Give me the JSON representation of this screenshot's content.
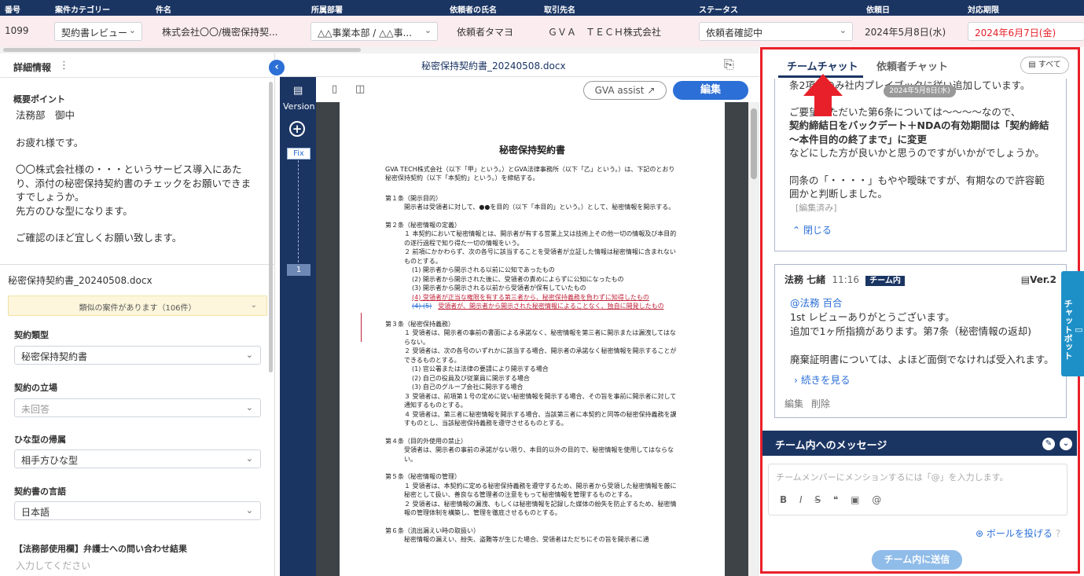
{
  "header": {
    "cols": [
      "番号",
      "案件カテゴリー",
      "件名",
      "所属部署",
      "依頼者の氏名",
      "取引先名",
      "ステータス",
      "依頼日",
      "対応期限"
    ]
  },
  "row": {
    "number": "1099",
    "category": "契約書レビュー",
    "subject": "株式会社〇〇/機密保持契...",
    "department": "△△事業本部 / △△事...",
    "requester": "依頼者タマヨ",
    "client": "ＧＶＡ　ＴＥＣＨ株式会社",
    "status": "依頼者確認中",
    "request_date": "2024年5月8日(水)",
    "deadline": "2024年6月7日(金)",
    "deadline_color": "#e8202a"
  },
  "left": {
    "title": "詳細情報",
    "summary_label": "概要ポイント",
    "summary_lines": [
      "法務部　御中",
      "お疲れ様です。",
      "〇〇株式会社様の・・・というサービス導入にあたり、添付の秘密保持契約書のチェックをお願いできますでしょうか。",
      "先方のひな型になります。",
      "ご確認のほど宜しくお願い致します。"
    ],
    "file_name": "秘密保持契約書_20240508.docx",
    "similar": "類似の案件があります（106件）",
    "fields": [
      {
        "label": "契約類型",
        "value": "秘密保持契約書"
      },
      {
        "label": "契約の立場",
        "value": "未回答"
      },
      {
        "label": "ひな型の帰属",
        "value": "相手方ひな型"
      },
      {
        "label": "契約書の言語",
        "value": "日本語"
      }
    ],
    "inquiry_label": "【法務部使用欄】弁護士への問い合わせ結果",
    "inquiry_placeholder": "入力してください"
  },
  "center": {
    "doc_name": "秘密保持契約書_20240508.docx",
    "version_label": "Version",
    "fix_label": "Fix",
    "version_one": "1",
    "assist_label": "GVA assist",
    "edit_label": "編集",
    "paper": {
      "title": "秘密保持契約書",
      "intro": "GVA TECH株式会社（以下「甲」という。）とGVA法律事務所（以下「乙」という。）は、下記のとおり秘密保持契約（以下「本契約」という。）を締結する。",
      "a1_title": "第１条（開示目的）",
      "a1_body": "開示者は受領者に対して、●●を目的（以下「本目的」という。）として、秘密情報を開示する。",
      "a2_title": "第２条（秘密情報の定義）",
      "a2_1": "１ 本契約において秘密情報とは、開示者が有する営業上又は技術上その他一切の情報及び本目的の遂行過程で知り得た一切の情報をいう。",
      "a2_2": "２ 前項にかかわらず、次の各号に該当することを受領者が立証した情報は秘密情報に含まれないものとする。",
      "a2_i1": "(1) 開示者から開示される以前に公知であったもの",
      "a2_i2": "(2) 開示者から開示された後に、受領者の責めによらずに公知になったもの",
      "a2_i3": "(3) 開示者から開示される以前から受領者が保有していたもの",
      "a2_i4": "(4) 受領者が正当な権限を有する第三者から、秘密保持義務を負わずに知得したもの",
      "a2_i5_old": "(4) (5)",
      "a2_i5": "受領者が、開示者から開示された秘密情報によることなく、独自に開発したもの",
      "a3_title": "第３条（秘密保持義務）",
      "a3_1": "１ 受領者は、開示者の事前の書面による承諾なく、秘密情報を第三者に開示または漏洩してはならない。",
      "a3_2": "２ 受領者は、次の各号のいずれかに該当する場合、開示者の承諾なく秘密情報を開示することができるものとする。",
      "a3_i1": "(1) 官公署または法律の要請により開示する場合",
      "a3_i2": "(2) 自己の役員及び従業員に開示する場合",
      "a3_i3": "(3) 自己のグループ会社に開示する場合",
      "a3_3": "３ 受領者は、前項第１号の定めに従い秘密情報を開示する場合、その旨を事前に開示者に対して通知するものとする。",
      "a3_4": "４ 受領者は、第三者に秘密情報を開示する場合、当該第三者に本契約と同等の秘密保持義務を課すものとし、当該秘密保持義務を遵守させるものとする。",
      "a4_title": "第４条（目的外使用の禁止）",
      "a4_body": "受領者は、開示者の事前の承諾がない限り、本目的以外の目的で、秘密情報を使用してはならない。",
      "a5_title": "第５条（秘密情報の管理）",
      "a5_1": "１ 受領者は、本契約に定める秘密保持義務を遵守するため、開示者から受領した秘密情報を厳に秘密として扱い、善良なる管理者の注意をもって秘密情報を管理するものとする。",
      "a5_2": "２ 受領者は、秘密情報の漏洩、もしくは秘密情報を記録した媒体の紛失を防止するため、秘密情報の管理体制を構築し、管理を徹底させるものとする。",
      "a6_title": "第６条（流出漏えい時の取扱い）",
      "a6_body": "秘密情報の漏えい、紛失、盗難等が生じた場合、受領者はただちにその旨を開示者に通"
    }
  },
  "right": {
    "tab_team": "チームチャット",
    "tab_requester": "依頼者チャット",
    "all_label": "すべて",
    "card1": {
      "line1": "条2項等のみ社内プレイブックに従い追加しています。",
      "date_pill": "2024年5月8日(水)",
      "p2_a": "ご要望いただいた第6条については～～～～なので、",
      "p2_bold": "契約締結日をバックデート＋NDAの有効期間は「契約締結～本件目的の終了まで」に変更",
      "p2_c": "などにした方が良いかと思うのですがいかがでしょうか。",
      "p3": "同条の「・・・・」もやや曖昧ですが、有期なので許容範囲かと判断しました。",
      "edited": "[編集済み]",
      "close": "閉じる"
    },
    "card2": {
      "author": "法務 七緒",
      "time": "11:16",
      "badge": "チーム内",
      "version": "Ver.2",
      "mention": "@法務 百合",
      "l1": "1st レビューありがとうございます。",
      "l2": "追加で1ヶ所指摘があります。第7条（秘密情報の返却)",
      "l3": "廃棄証明書については、よほど面倒でなければ受入れます。",
      "more": "続きを見る",
      "edit": "編集",
      "delete": "削除"
    },
    "chatbot": "チャットボット",
    "msg_header": "チーム内へのメッセージ",
    "msg_placeholder": "チームメンバーにメンションするには「@」を入力します。",
    "toolbar_icons": [
      "bold-icon",
      "italic-icon",
      "strikethrough-icon",
      "quote-icon",
      "image-icon",
      "mention-icon"
    ],
    "ball_label": "ボールを投げる",
    "send_label": "チーム内に送信"
  },
  "colors": {
    "navy": "#1b3563",
    "accent": "#2c6fd6",
    "highlight": "#e8202a"
  }
}
